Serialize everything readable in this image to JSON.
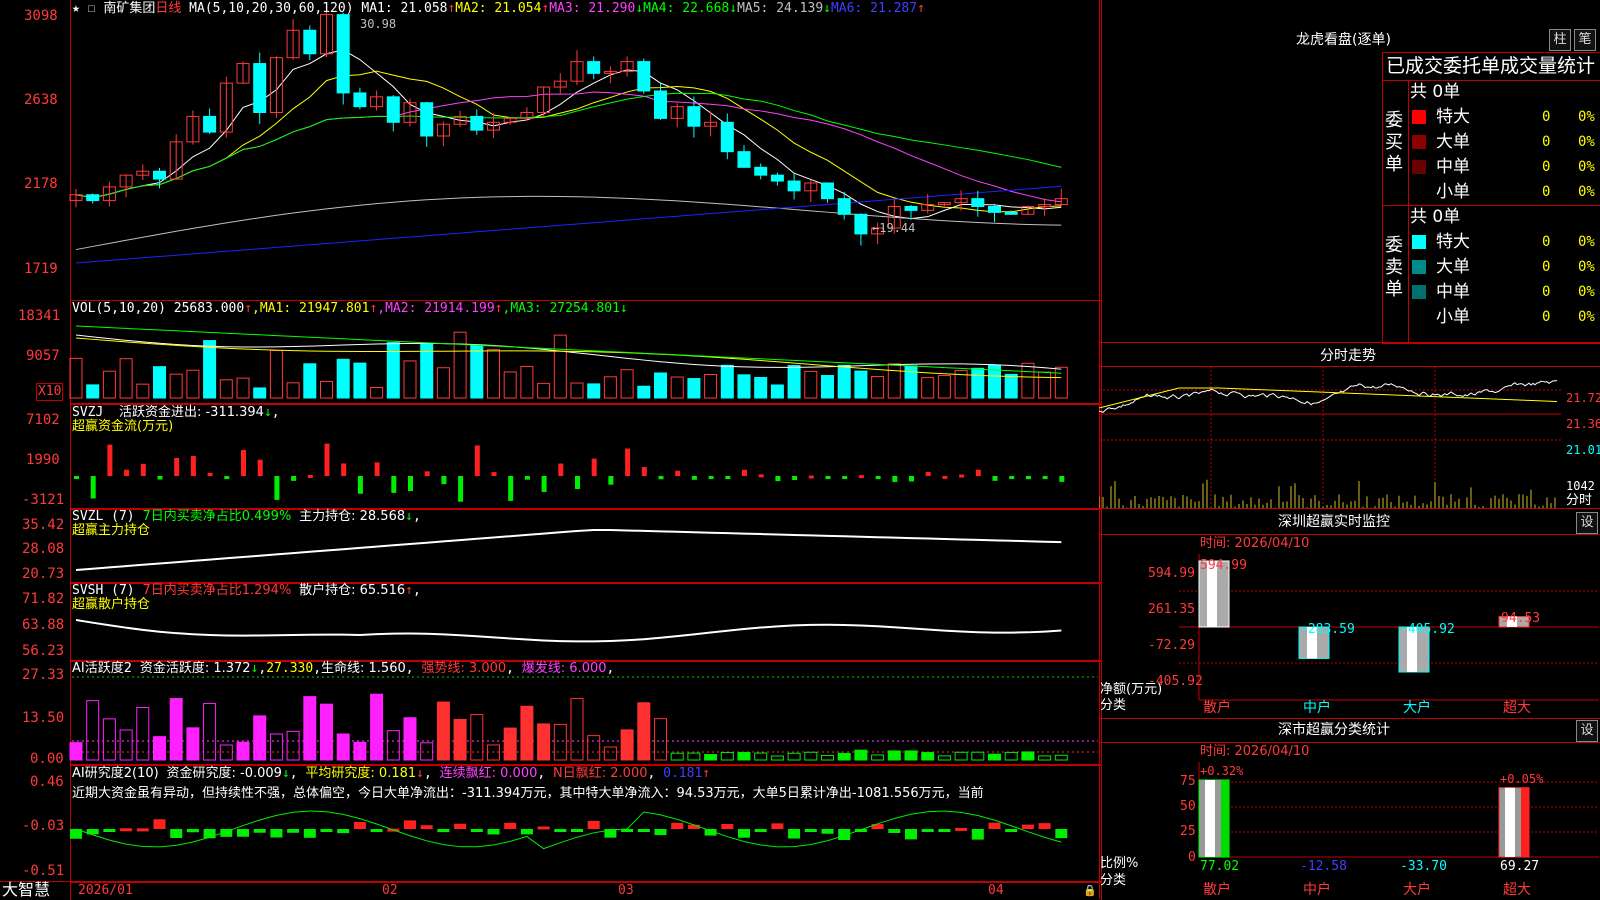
{
  "stock": {
    "name": "南矿集团",
    "period": "日线",
    "ma_label": "MA(5,10,20,30,60,120)",
    "ma1": "MA1: 21.058",
    "ma2": "MA2: 21.054",
    "ma3": "MA3: 21.290",
    "ma4": "MA4: 22.668",
    "ma5": "MA5: 24.139",
    "ma6": "MA6: 21.287",
    "high_label": "30.98",
    "low_label": "19.44",
    "y_ticks": [
      "3098",
      "2638",
      "2178",
      "1719"
    ]
  },
  "vol": {
    "title": "VOL(5,10,20)",
    "value": "25683.000",
    "ma1": "MA1: 21947.801",
    "ma2": "MA2: 21914.199",
    "ma3": "MA3: 27254.801",
    "y_ticks": [
      "18341",
      "9057"
    ],
    "multiplier": "X10"
  },
  "svzj": {
    "title": "SVZJ",
    "label": "活跃资金进出: -311.394",
    "sub": "超赢资金流(万元)",
    "y_ticks": [
      "7102",
      "1990",
      "-3121"
    ]
  },
  "svzl": {
    "title": "SVZL (7)",
    "label1": "7日内买卖净占比0.499%",
    "label2": "主力持仓: 28.568",
    "sub": "超赢主力持仓",
    "y_ticks": [
      "35.42",
      "28.08",
      "20.73"
    ]
  },
  "svsh": {
    "title": "SVSH (7)",
    "label1": "7日内买卖净占比1.294%",
    "label2": "散户持仓: 65.516",
    "sub": "超赢散户持仓",
    "y_ticks": [
      "71.82",
      "63.88",
      "56.23"
    ]
  },
  "ai_active": {
    "title": "AI活跃度2",
    "label1": "资金活跃度: 1.372",
    "label2": "27.330",
    "label3": "生命线: 1.560",
    "label4": "强势线: 3.000",
    "label5": "爆发线: 6.000",
    "y_ticks": [
      "27.33",
      "13.50",
      "0.00"
    ]
  },
  "ai_research": {
    "title": "AI研究度2(10)",
    "label1": "资金研究度: -0.009",
    "label2": "平均研究度: 0.181",
    "label3": "连续飘红: 0.000",
    "label4": "N日飘红: 2.000",
    "label5": "0.181",
    "comment": "近期大资金虽有异动，但持续性不强，总体偏空，今日大单净流出：-311.394万元，其中特大单净流入：94.53万元，大单5日累计净出-1081.556万元，当前",
    "y_ticks": [
      "0.46",
      "-0.03",
      "-0.51"
    ]
  },
  "bottom": {
    "brand": "大智慧",
    "dates": [
      "2026/01",
      "02",
      "03",
      "04"
    ]
  },
  "right": {
    "dragon_title": "龙虎看盘(逐单)",
    "btn_bar": "柱",
    "btn_pen": "笔",
    "order_header": "已成交委托单成交量统计",
    "buy_side": "委买单",
    "sell_side": "委卖单",
    "buy_total": "共 0单",
    "sell_total": "共 0单",
    "buy_rows": [
      {
        "label": "特大",
        "count": "0",
        "pct": "0%",
        "color": "#ff0000"
      },
      {
        "label": "大单",
        "count": "0",
        "pct": "0%",
        "color": "#8b0000"
      },
      {
        "label": "中单",
        "count": "0",
        "pct": "0%",
        "color": "#6b0000"
      },
      {
        "label": "小单",
        "count": "0",
        "pct": "0%",
        "color": "#000000"
      }
    ],
    "sell_rows": [
      {
        "label": "特大",
        "count": "0",
        "pct": "0%",
        "color": "#00ffff"
      },
      {
        "label": "大单",
        "count": "0",
        "pct": "0%",
        "color": "#008b8b"
      },
      {
        "label": "中单",
        "count": "0",
        "pct": "0%",
        "color": "#007070"
      },
      {
        "label": "小单",
        "count": "0",
        "pct": "0%",
        "color": "#000000"
      }
    ],
    "intraday_title": "分时走势",
    "intraday_prices": [
      "21.72",
      "21.36",
      "21.01"
    ],
    "intraday_vol": "1042",
    "intraday_unit": "分时",
    "monitor_title": "深圳超赢实时监控",
    "monitor_btn": "设",
    "monitor_time": "时间: 2026/04/10",
    "monitor_yticks": [
      "594.99",
      "261.35",
      "-72.29",
      "-405.92"
    ],
    "monitor_ylabel1": "净额(万元)",
    "monitor_ylabel2": "分类",
    "monitor_categories": [
      "散户",
      "中户",
      "大户",
      "超大"
    ],
    "monitor_values": [
      "594.99",
      "-283.59",
      "-405.92",
      "94.53"
    ],
    "class_title": "深市超赢分类统计",
    "class_btn": "设",
    "class_time": "时间: 2026/04/10",
    "class_yticks": [
      "75",
      "50",
      "25",
      "0"
    ],
    "class_ylabel1": "比例%",
    "class_ylabel2": "分类",
    "class_top_labels": [
      "+0.32%",
      "+0.05%"
    ],
    "class_values": [
      "77.02",
      "-12.58",
      "-33.70",
      "69.27"
    ],
    "class_categories": [
      "散户",
      "中户",
      "大户",
      "超大"
    ]
  },
  "colors": {
    "up": "#ff3a3a",
    "down": "#00ffff",
    "border": "#c00000",
    "ma1": "#ffffff",
    "ma2": "#ffff00",
    "ma3": "#ff40ff",
    "ma4": "#00ff00",
    "ma5": "#c0c0c0",
    "ma6": "#2020ff"
  }
}
